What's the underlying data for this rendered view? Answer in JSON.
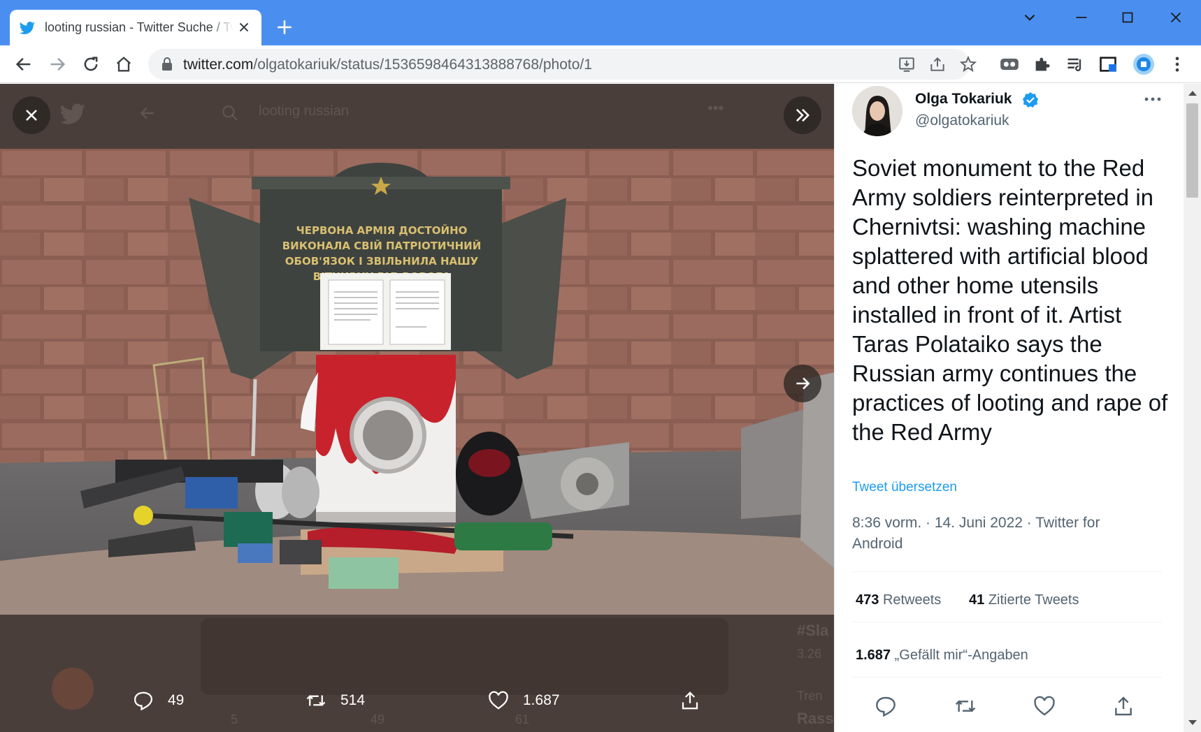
{
  "browser": {
    "tab_title": "looting russian - Twitter Suche / Twitter",
    "url_host": "twitter.com",
    "url_path": "/olgatokariuk/status/1536598464313888768/photo/1",
    "accent_color": "#4a8ff0"
  },
  "background_page": {
    "search_text": "looting russian",
    "trend_tag": "#Sla",
    "trend_count": "3.26",
    "trend_label": "Tren",
    "trend_next": "Rass",
    "bg_reply": "5",
    "bg_retweet": "49",
    "bg_like": "61"
  },
  "photo_actions": {
    "replies": "49",
    "retweets": "514",
    "likes": "1.687"
  },
  "tweet": {
    "author_name": "Olga Tokariuk",
    "author_handle": "@olgatokariuk",
    "text": "Soviet monument to the Red Army soldiers reinterpreted in Chernivtsi: washing machine splattered with artificial blood and other home utensils installed in front of it. Artist Taras Polataiko says the Russian army continues the practices of looting and rape of the Red Army",
    "translate_label": "Tweet übersetzen",
    "timestamp": "8:36 vorm. · 14. Juni 2022 · Twitter for Android",
    "retweets_count": "473",
    "retweets_label": "Retweets",
    "quotes_count": "41",
    "quotes_label": "Zitierte Tweets",
    "likes_count": "1.687",
    "likes_label": "„Gefällt mir“-Angaben",
    "link_color": "#1d9bf0"
  },
  "plaque_text": [
    "ЧЕРВОНА АРМІЯ ДОСТОЙНО",
    "ВИКОНАЛА СВІЙ ПАТРІОТИЧНИЙ",
    "ОБОВ'ЯЗОК І ЗВІЛЬНИЛА НАШУ",
    "ВІТЧИЗНУ ВІД ВОРОГА"
  ]
}
